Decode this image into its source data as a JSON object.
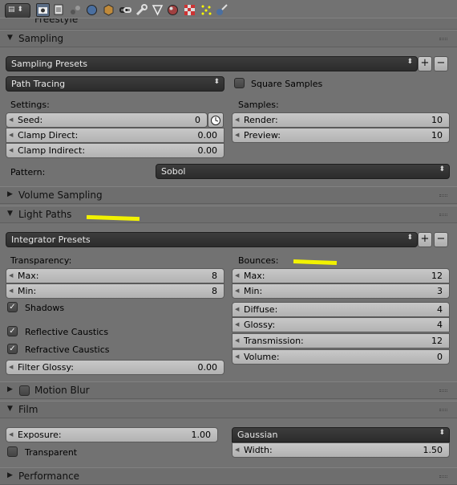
{
  "header_icons": [
    "render-icon",
    "render-layers-icon",
    "scene-icon",
    "world-icon",
    "object-icon",
    "constraints-icon",
    "modifiers-icon",
    "data-icon",
    "material-icon",
    "texture-icon",
    "particles-icon",
    "physics-icon"
  ],
  "top_partial": "Freestyle",
  "sampling": {
    "title": "Sampling",
    "presets": "Sampling Presets",
    "mode": "Path Tracing",
    "square_samples": "Square Samples",
    "settings_label": "Settings:",
    "samples_label": "Samples:",
    "seed": {
      "label": "Seed:",
      "value": "0"
    },
    "clamp_direct": {
      "label": "Clamp Direct:",
      "value": "0.00"
    },
    "clamp_indirect": {
      "label": "Clamp Indirect:",
      "value": "0.00"
    },
    "render": {
      "label": "Render:",
      "value": "10"
    },
    "preview": {
      "label": "Preview:",
      "value": "10"
    },
    "pattern_label": "Pattern:",
    "pattern": "Sobol"
  },
  "volume_sampling": {
    "title": "Volume Sampling"
  },
  "light_paths": {
    "title": "Light Paths",
    "presets": "Integrator Presets",
    "transparency_label": "Transparency:",
    "bounces_label": "Bounces:",
    "t_max": {
      "label": "Max:",
      "value": "8"
    },
    "t_min": {
      "label": "Min:",
      "value": "8"
    },
    "shadows": "Shadows",
    "reflective": "Reflective Caustics",
    "refractive": "Refractive Caustics",
    "filter_glossy": {
      "label": "Filter Glossy:",
      "value": "0.00"
    },
    "b_max": {
      "label": "Max:",
      "value": "12"
    },
    "b_min": {
      "label": "Min:",
      "value": "3"
    },
    "diffuse": {
      "label": "Diffuse:",
      "value": "4"
    },
    "glossy": {
      "label": "Glossy:",
      "value": "4"
    },
    "transmission": {
      "label": "Transmission:",
      "value": "12"
    },
    "volume": {
      "label": "Volume:",
      "value": "0"
    }
  },
  "motion_blur": {
    "title": "Motion Blur"
  },
  "film": {
    "title": "Film",
    "exposure": {
      "label": "Exposure:",
      "value": "1.00"
    },
    "transparent": "Transparent",
    "filter": "Gaussian",
    "width": {
      "label": "Width:",
      "value": "1.50"
    }
  },
  "performance": {
    "title": "Performance"
  },
  "colors": {
    "panel": "#727272",
    "header": "#6e6e6e",
    "field": "#bdbdbd",
    "dark_field": "#333333",
    "annotation": "#f2f200"
  }
}
